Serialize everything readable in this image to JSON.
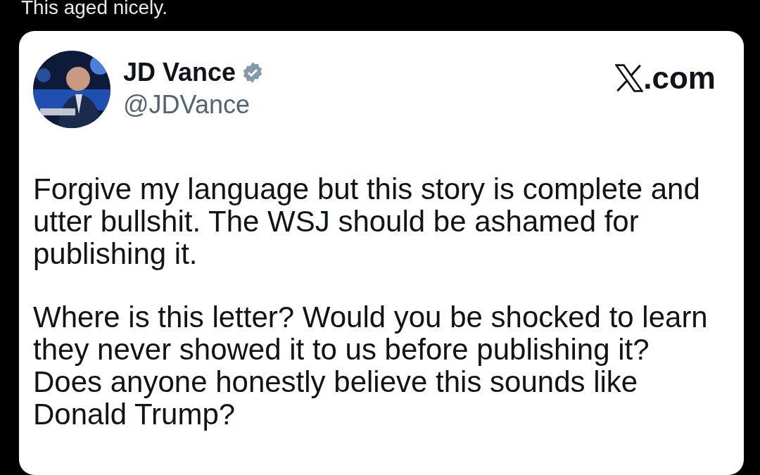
{
  "post": {
    "caption": "This aged nicely."
  },
  "embedded_tweet": {
    "author": {
      "name": "JD Vance",
      "verified": true,
      "handle": "@JDVance"
    },
    "source": ".com",
    "paragraphs": [
      "Forgive my language but this story is complete and utter bullshit. The WSJ should be ashamed for publishing it.",
      "Where is this letter? Would you be shocked to learn they never showed it to us before publishing it? Does anyone honestly believe this sounds like Donald Trump?"
    ]
  }
}
